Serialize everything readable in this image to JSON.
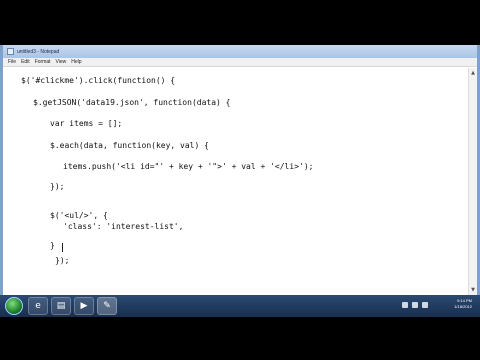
{
  "window": {
    "title": "untitled3 - Notepad",
    "menu": [
      "File",
      "Edit",
      "Format",
      "View",
      "Help"
    ]
  },
  "code": [
    "$('#clickme').click(function() {",
    "$.getJSON('data19.json', function(data) {",
    "var items = [];",
    "$.each(data, function(key, val) {",
    "items.push('<li id=\"' + key + '\">' + val + '</li>');",
    "});",
    "$('<ul/>', {",
    "'class': 'interest-list',",
    "}",
    "});"
  ],
  "taskbar": {
    "pinned": [
      "ie-icon",
      "explorer-icon",
      "media-player-icon",
      "notepad-icon"
    ]
  },
  "clock": {
    "time": "9:14 PM",
    "date": "1/18/2012"
  }
}
